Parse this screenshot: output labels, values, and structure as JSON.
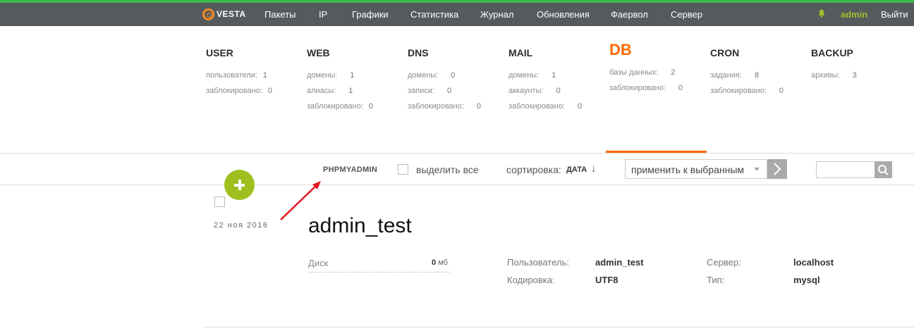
{
  "header": {
    "logo_text": "VESTA",
    "nav": [
      "Пакеты",
      "IP",
      "Графики",
      "Статистика",
      "Журнал",
      "Обновления",
      "Фаервол",
      "Сервер"
    ],
    "user": "admin",
    "logout": "Выйти"
  },
  "stats": [
    {
      "title": "USER",
      "rows": [
        {
          "label": "пользователи:",
          "value": "1"
        },
        {
          "label": "заблокировано:",
          "value": "0"
        }
      ]
    },
    {
      "title": "WEB",
      "rows": [
        {
          "label": "домены:",
          "value": "1"
        },
        {
          "label": "алиасы:",
          "value": "1"
        },
        {
          "label": "заблокировано:",
          "value": "0"
        }
      ]
    },
    {
      "title": "DNS",
      "rows": [
        {
          "label": "домены:",
          "value": "0"
        },
        {
          "label": "записи:",
          "value": "0"
        },
        {
          "label": "заблокировано:",
          "value": "0"
        }
      ]
    },
    {
      "title": "MAIL",
      "rows": [
        {
          "label": "домены:",
          "value": "1"
        },
        {
          "label": "аккаунты:",
          "value": "0"
        },
        {
          "label": "заблокировано:",
          "value": "0"
        }
      ]
    },
    {
      "title": "DB",
      "rows": [
        {
          "label": "базы данных:",
          "value": "2"
        },
        {
          "label": "заблокировано:",
          "value": "0"
        }
      ]
    },
    {
      "title": "CRON",
      "rows": [
        {
          "label": "задания:",
          "value": "8"
        },
        {
          "label": "заблокировано:",
          "value": "0"
        }
      ]
    },
    {
      "title": "BACKUP",
      "rows": [
        {
          "label": "архивы:",
          "value": "3"
        }
      ]
    }
  ],
  "toolbar": {
    "phpmyadmin": "PHPMYADMIN",
    "select_all": "выделить все",
    "sort_label": "сортировка:",
    "sort_value": "ДАТА",
    "sort_arrow": "↓",
    "bulk_action": "применить к выбранным"
  },
  "db_row": {
    "date": "22 ноя 2016",
    "name": "admin_test",
    "disk_label": "Диск",
    "disk_value": "0",
    "disk_unit": "мб",
    "user_label": "Пользователь:",
    "user_value": "admin_test",
    "encoding_label": "Кодировка:",
    "encoding_value": "UTF8",
    "server_label": "Сервер:",
    "server_value": "localhost",
    "type_label": "Тип:",
    "type_value": "mysql"
  },
  "colors": {
    "accent": "#ff6701",
    "green": "#9fbf1e",
    "topline": "#3db84a",
    "navbar": "#555a5c",
    "annotation": "#e3161b"
  }
}
